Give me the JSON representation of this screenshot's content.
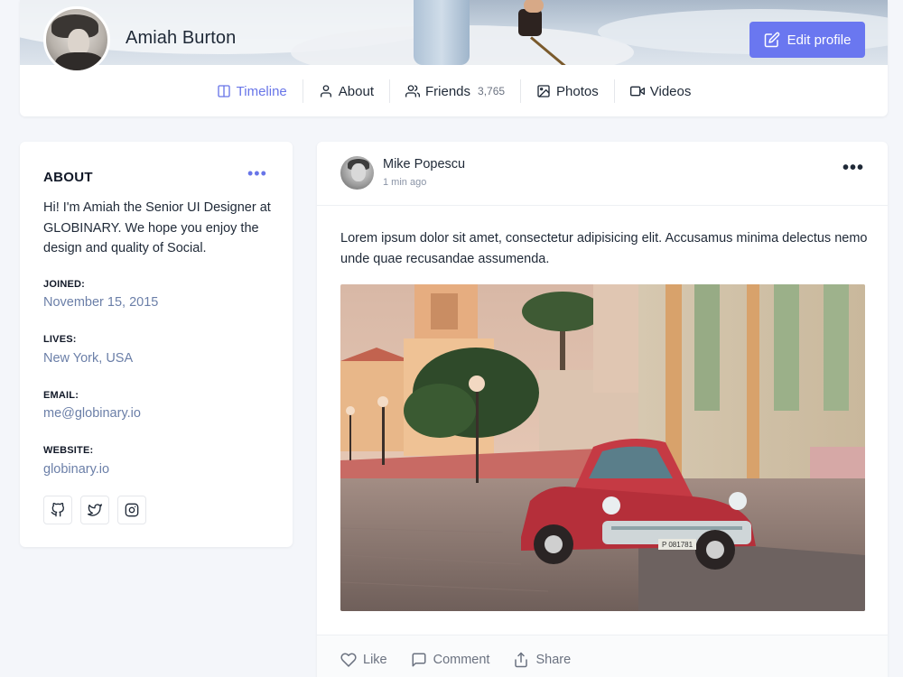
{
  "profile": {
    "name": "Amiah Burton",
    "edit_label": "Edit profile"
  },
  "tabs": [
    {
      "label": "Timeline",
      "icon": "columns-icon",
      "active": true
    },
    {
      "label": "About",
      "icon": "user-icon"
    },
    {
      "label": "Friends",
      "icon": "users-icon",
      "count": "3,765"
    },
    {
      "label": "Photos",
      "icon": "image-icon"
    },
    {
      "label": "Videos",
      "icon": "video-icon"
    }
  ],
  "about": {
    "title": "ABOUT",
    "bio": "Hi! I'm Amiah the Senior UI Designer at GLOBINARY. We hope you enjoy the design and quality of Social.",
    "fields": [
      {
        "label": "JOINED:",
        "value": "November 15, 2015"
      },
      {
        "label": "LIVES:",
        "value": "New York, USA"
      },
      {
        "label": "EMAIL:",
        "value": "me@globinary.io"
      },
      {
        "label": "WEBSITE:",
        "value": "globinary.io"
      }
    ],
    "social": [
      "github-icon",
      "twitter-icon",
      "instagram-icon"
    ]
  },
  "post": {
    "author": "Mike Popescu",
    "time": "1 min ago",
    "text": "Lorem ipsum dolor sit amet, consectetur adipisicing elit. Accusamus minima delectus nemo unde quae recusandae assumenda.",
    "plate": "P 081781",
    "actions": {
      "like": "Like",
      "comment": "Comment",
      "share": "Share"
    }
  },
  "colors": {
    "accent": "#6a77f0",
    "link_gray": "#6b7fa8",
    "background": "#f4f6fa"
  }
}
